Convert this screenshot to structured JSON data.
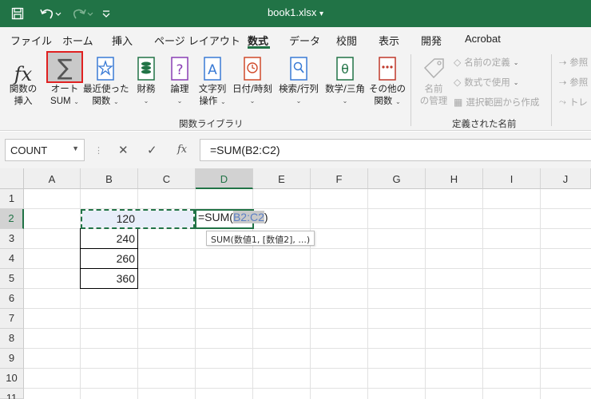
{
  "title_bar": {
    "title": "book1.xlsx",
    "title_dropdown": "▾",
    "bg_color": "#217346",
    "qat": [
      "save-icon",
      "undo-icon",
      "redo-icon",
      "customize-qat-icon"
    ]
  },
  "tabs": [
    "ファイル",
    "ホーム",
    "挿入",
    "ページ レイアウト",
    "数式",
    "データ",
    "校閲",
    "表示",
    "開発",
    "Acrobat"
  ],
  "active_tab": "数式",
  "ribbon": {
    "insert_function": {
      "line1": "関数の",
      "line2": "挿入"
    },
    "autosum": {
      "line1": "オート",
      "line2": "SUM"
    },
    "recent": {
      "line1": "最近使った",
      "line2": "関数"
    },
    "financial": {
      "line1": "財務"
    },
    "logical": {
      "line1": "論理"
    },
    "text": {
      "line1": "文字列",
      "line2": "操作"
    },
    "datetime": {
      "line1": "日付/時刻"
    },
    "lookup": {
      "line1": "検索/行列"
    },
    "math": {
      "line1": "数学/三角"
    },
    "more": {
      "line1": "その他の",
      "line2": "関数"
    },
    "group_library": "関数ライブラリ",
    "name_manager": {
      "line1": "名前",
      "line2": "の管理"
    },
    "define_name": "名前の定義",
    "use_in_formula": "数式で使用",
    "create_from_selection": "選択範囲から作成",
    "group_names": "定義された名前",
    "trace_precedents": "参照",
    "trace_dependents": "参照",
    "remove_arrows": "トレ"
  },
  "formula_bar": {
    "name_box": "COUNT",
    "cancel": "✕",
    "enter": "✓",
    "fx": "fx",
    "formula": "=SUM(B2:C2)"
  },
  "grid": {
    "columns": [
      "A",
      "B",
      "C",
      "D",
      "E",
      "F",
      "G",
      "H",
      "I",
      "J"
    ],
    "active_column": "D",
    "rows": [
      "1",
      "2",
      "3",
      "4",
      "5",
      "6",
      "7",
      "8",
      "9",
      "10",
      "11"
    ],
    "active_row": "2",
    "cells": {
      "B2": "120",
      "B3": "240",
      "B4": "260",
      "B5": "360"
    },
    "editing_cell": {
      "prefix": "=SUM(",
      "ref": "B2:C2",
      "suffix": ")"
    },
    "tooltip": "SUM(数値1, [数値2], ...)"
  }
}
